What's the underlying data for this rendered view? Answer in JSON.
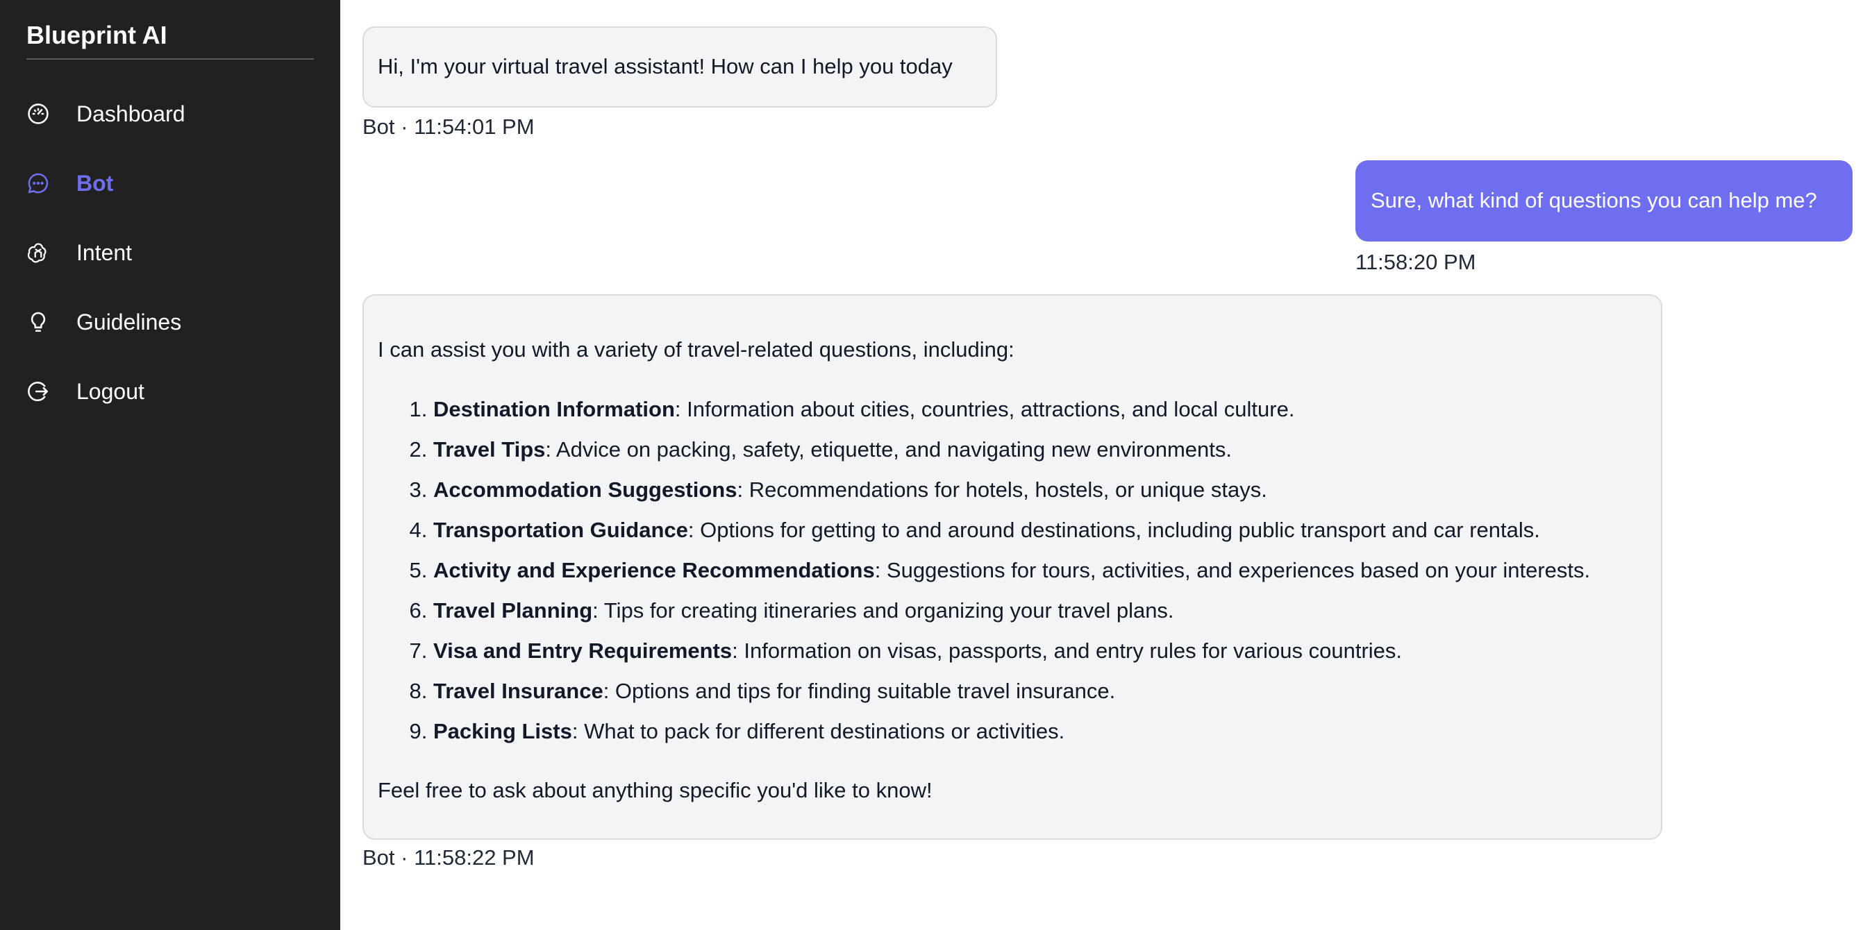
{
  "sidebar": {
    "brand": "Blueprint AI",
    "items": [
      {
        "label": "Dashboard",
        "icon": "gauge-icon",
        "active": false
      },
      {
        "label": "Bot",
        "icon": "chat-bubble-icon",
        "active": true
      },
      {
        "label": "Intent",
        "icon": "openai-knot-icon",
        "active": false
      },
      {
        "label": "Guidelines",
        "icon": "lightbulb-icon",
        "active": false
      },
      {
        "label": "Logout",
        "icon": "logout-icon",
        "active": false
      }
    ]
  },
  "colors": {
    "sidebar_bg": "#212121",
    "accent": "#6f6ef0",
    "bot_bubble_bg": "#f3f4f6"
  },
  "messages": [
    {
      "sender": "bot",
      "text": "Hi, I'm your virtual travel assistant! How can I help you today",
      "meta": "Bot · 11:54:01 PM"
    },
    {
      "sender": "user",
      "text": "Sure, what kind of questions you can help me?",
      "meta": "11:58:20 PM"
    },
    {
      "sender": "bot",
      "intro": "I can assist you with a variety of travel-related questions, including:",
      "list": [
        {
          "title": "Destination Information",
          "desc": ": Information about cities, countries, attractions, and local culture."
        },
        {
          "title": "Travel Tips",
          "desc": ": Advice on packing, safety, etiquette, and navigating new environments."
        },
        {
          "title": "Accommodation Suggestions",
          "desc": ": Recommendations for hotels, hostels, or unique stays."
        },
        {
          "title": "Transportation Guidance",
          "desc": ": Options for getting to and around destinations, including public transport and car rentals."
        },
        {
          "title": "Activity and Experience Recommendations",
          "desc": ": Suggestions for tours, activities, and experiences based on your interests."
        },
        {
          "title": "Travel Planning",
          "desc": ": Tips for creating itineraries and organizing your travel plans."
        },
        {
          "title": "Visa and Entry Requirements",
          "desc": ": Information on visas, passports, and entry rules for various countries."
        },
        {
          "title": "Travel Insurance",
          "desc": ": Options and tips for finding suitable travel insurance."
        },
        {
          "title": "Packing Lists",
          "desc": ": What to pack for different destinations or activities."
        }
      ],
      "outro": "Feel free to ask about anything specific you'd like to know!",
      "meta": "Bot · 11:58:22 PM"
    }
  ]
}
